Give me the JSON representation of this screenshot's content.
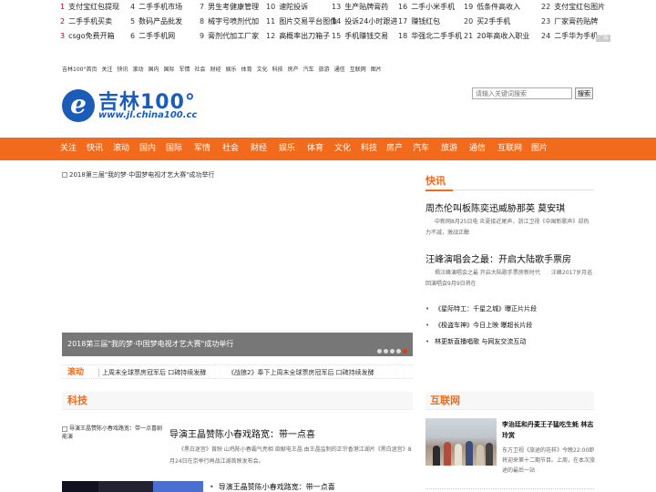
{
  "top_links": [
    {
      "n": "1",
      "t": "支付宝红包提现"
    },
    {
      "n": "4",
      "t": "二手手机市场"
    },
    {
      "n": "7",
      "t": "男生考健康管理"
    },
    {
      "n": "10",
      "t": "速陀投诉"
    },
    {
      "n": "13",
      "t": "生产贴牌膏药"
    },
    {
      "n": "16",
      "t": "二手小米手机"
    },
    {
      "n": "19",
      "t": "低条件高收入"
    },
    {
      "n": "22",
      "t": "支付宝红包图片"
    },
    {
      "n": "2",
      "t": "二手手机买卖"
    },
    {
      "n": "5",
      "t": "数码产品批发"
    },
    {
      "n": "8",
      "t": "械字号喷剂代加"
    },
    {
      "n": "11",
      "t": "图片交易平台图像"
    },
    {
      "n": "14",
      "t": "投诉24小时跟进"
    },
    {
      "n": "17",
      "t": "赚钱红包"
    },
    {
      "n": "20",
      "t": "买2手手机"
    },
    {
      "n": "23",
      "t": "厂家膏药贴牌"
    },
    {
      "n": "3",
      "t": "csgo免费开箱"
    },
    {
      "n": "6",
      "t": "二手手机网"
    },
    {
      "n": "9",
      "t": "膏剂代加工厂家"
    },
    {
      "n": "12",
      "t": "高概率出刀箱子"
    },
    {
      "n": "15",
      "t": "手机赚钱交易"
    },
    {
      "n": "18",
      "t": "华强北二手手机"
    },
    {
      "n": "21",
      "t": "20年高收入职业"
    },
    {
      "n": "24",
      "t": "二手华为手机"
    }
  ],
  "ad_tag": "广告",
  "mini_nav": [
    "吉林100°首页",
    "关注",
    "快讯",
    "滚动",
    "国内",
    "国际",
    "军情",
    "社会",
    "财经",
    "娱乐",
    "体育",
    "文化",
    "科技",
    "房产",
    "汽车",
    "旅游",
    "通信",
    "互联网",
    "图片"
  ],
  "logo": {
    "mark": "e",
    "cn": "吉林100°",
    "url": "www.jl.china100.cc"
  },
  "search": {
    "placeholder": "请输入关键词搜索",
    "button": "搜索"
  },
  "main_nav": [
    "关注",
    "快讯",
    "滚动",
    "国内",
    "国际",
    "军情",
    "社会",
    "财经",
    "娱乐",
    "体育",
    "文化",
    "科技",
    "房产",
    "汽车",
    "旅游",
    "通信",
    "互联网",
    "图片"
  ],
  "slide": {
    "img_alt": "2018第三届\"我的梦·中国梦电视才艺大赛\"成功举行",
    "caption": "2018第三届\"我的梦·中国梦电视才艺大赛\"成功举行",
    "dots": 5,
    "active_dot": 4
  },
  "scroll": {
    "label": "滚动",
    "items": [
      "上周末全球票房冠军后 口碑持续发酵",
      "《战狼2》奉下上周末全球票房冠军后 口碑持续发酵"
    ]
  },
  "kuaixun": {
    "head": "快讯",
    "h1": "周杰伦叫板陈奕迅威胁那英 莫安琪",
    "d1": "中新网8月25日电 炎夏接近尾声，浙江卫视《中国新歌声》却热力不减，激战正酣",
    "h2": "汪峰演唱会之最：开启大陆歌手票房",
    "d2": "揭汪峰演唱会之最 开启大陆歌手票房新时代　　汪峰2017岁月巡回演唱会9月9日将在",
    "bullets": [
      "《星际特工：千星之城》曝正片片段",
      "《极盗车神》今日上映 曝超长片段",
      "林更新直播唱歌 与网友交流互动"
    ]
  },
  "keji": {
    "head": "科技",
    "img_alt": "导演王晶赞陈小春戏路宽：带一点喜剧能演",
    "title": "导演王晶赞陈小春戏路宽：带一点喜",
    "desc": "《黑白迷宫》首映 山鸡陈小春霸气亮相 欲献电王晶 由王晶监制的正宗香港江湖片《黑白迷宫》8月24日在京举行再战江湖首映发布会。",
    "bullet2": "导演王晶赞陈小春戏路宽：带一点喜"
  },
  "hulianwang": {
    "head": "互联网",
    "title": "李治廷和丹麦王子猛吃生蚝 林志玲赏",
    "desc": "东方卫视《旅途的花样》今晚22:00即将迎来第十二期节目。上周，在本次旅途的最后一站"
  }
}
